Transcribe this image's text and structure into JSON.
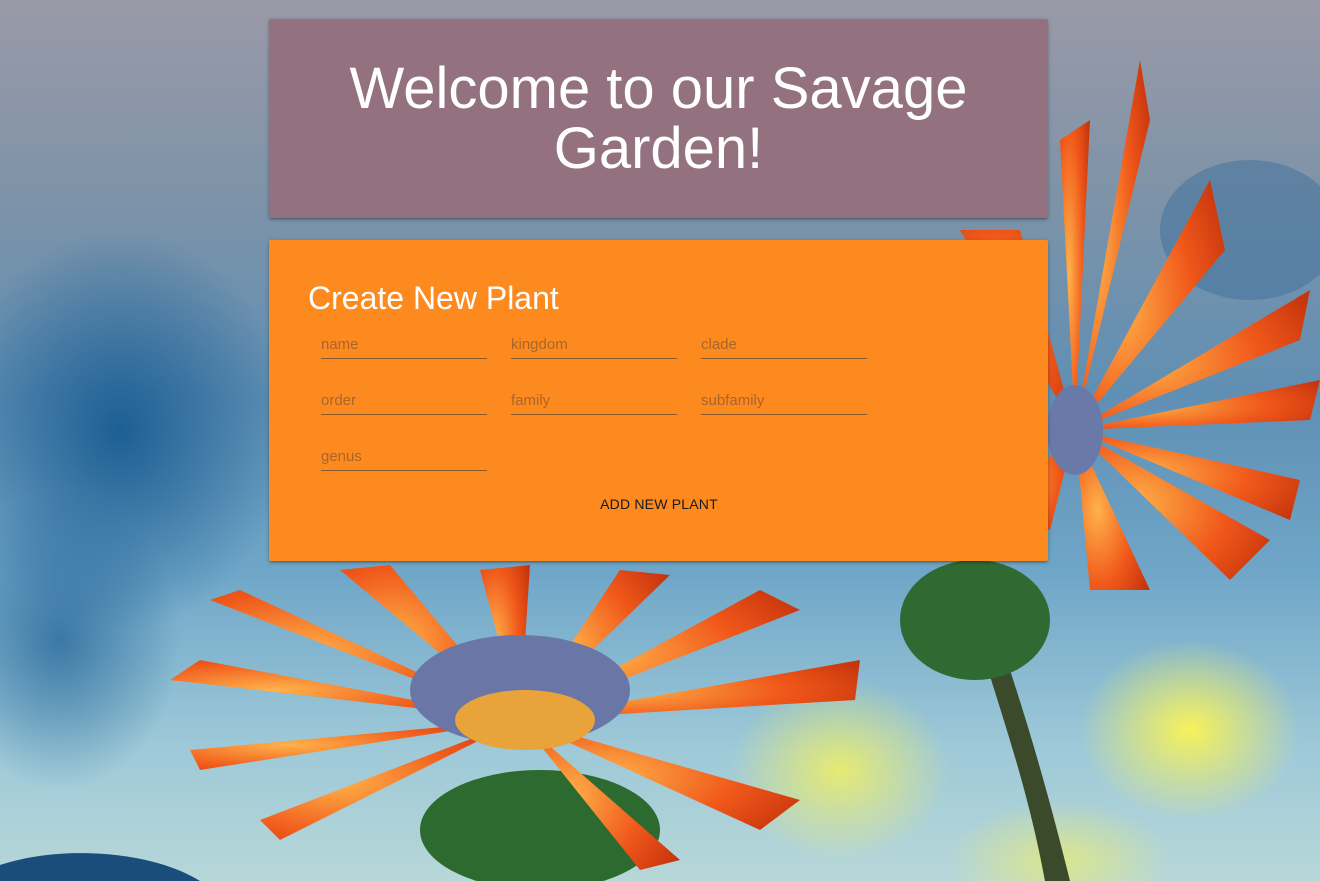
{
  "header": {
    "title": "Welcome to our Savage Garden!"
  },
  "form": {
    "title": "Create New Plant",
    "fields": [
      {
        "placeholder": "name",
        "value": ""
      },
      {
        "placeholder": "kingdom",
        "value": ""
      },
      {
        "placeholder": "clade",
        "value": ""
      },
      {
        "placeholder": "order",
        "value": ""
      },
      {
        "placeholder": "family",
        "value": ""
      },
      {
        "placeholder": "subfamily",
        "value": ""
      },
      {
        "placeholder": "genus",
        "value": ""
      }
    ],
    "submit_label": "ADD NEW PLANT"
  },
  "colors": {
    "header_bg": "#93717f",
    "form_bg": "#fd8a1f",
    "title_text": "#ffffff"
  }
}
